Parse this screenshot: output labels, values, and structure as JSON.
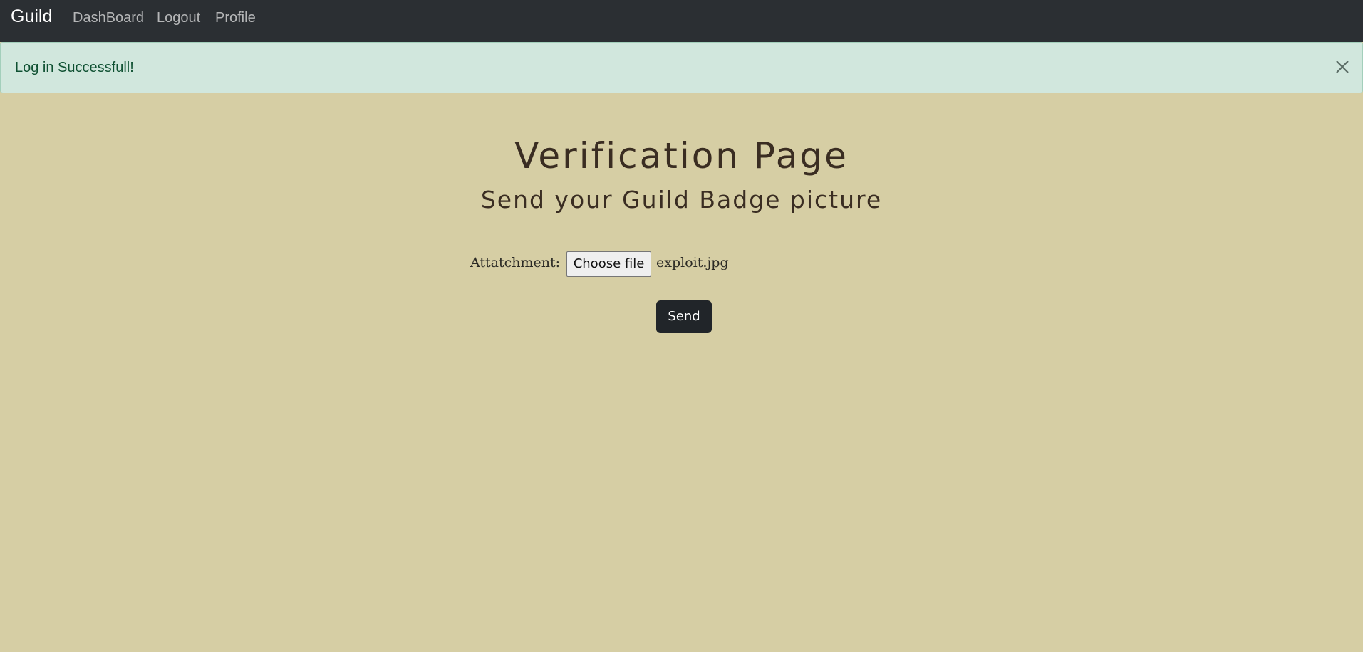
{
  "navbar": {
    "brand": "Guild",
    "links": [
      {
        "label": "DashBoard"
      },
      {
        "label": "Logout"
      },
      {
        "label": "Profile"
      }
    ],
    "background": "#2b2f33"
  },
  "alert": {
    "message": "Log in Successfull!",
    "close_icon": "close-icon",
    "background": "#d1e7dd",
    "text_color": "#0f5132"
  },
  "main": {
    "title": "Verification Page",
    "subtitle": "Send your Guild Badge picture",
    "form": {
      "attachment_label": "Attatchment:",
      "choose_file_label": "Choose file",
      "selected_file": "exploit.jpg",
      "send_label": "Send"
    },
    "background": "#d6cea4"
  }
}
